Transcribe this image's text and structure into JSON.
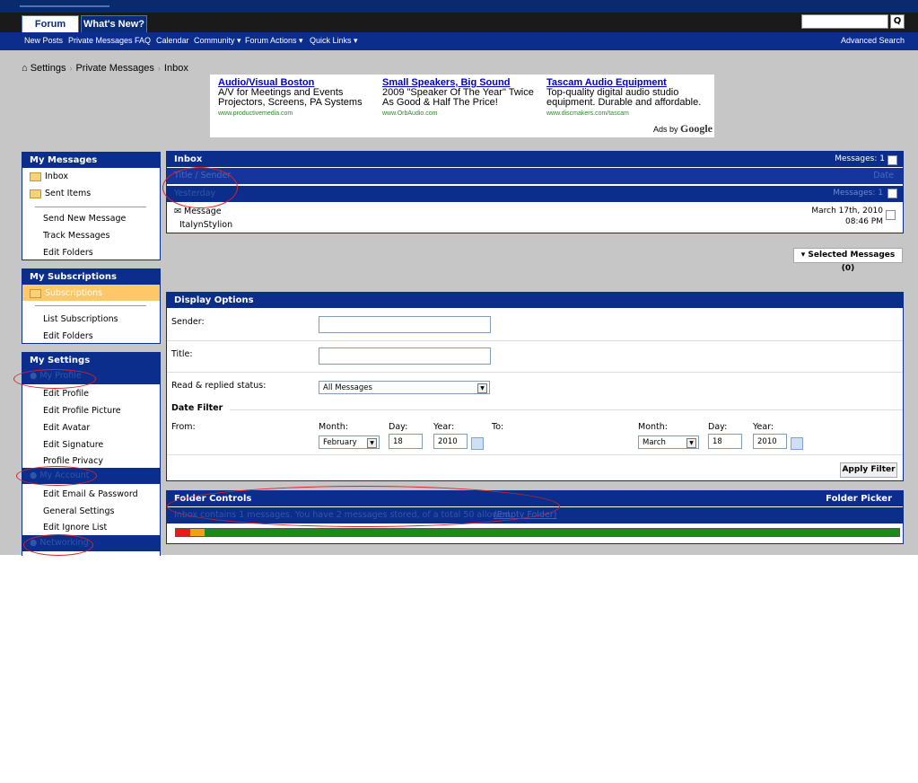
{
  "header": {
    "tabs": [
      {
        "label": "Forum"
      },
      {
        "label": "What's New?"
      }
    ],
    "search_button": "Q"
  },
  "subnav": {
    "items": [
      "New Posts",
      "Private Messages",
      "FAQ",
      "Calendar",
      "Community ▾",
      "Forum Actions ▾",
      "Quick Links ▾"
    ],
    "advanced_search": "Advanced Search"
  },
  "breadcrumb": {
    "items": [
      "Settings",
      "Private Messages",
      "Inbox"
    ]
  },
  "ads": {
    "items": [
      {
        "title": "Audio/Visual Boston",
        "line1": "A/V for Meetings and Events",
        "line2": "Projectors, Screens, PA Systems",
        "url": "www.productivemedia.com"
      },
      {
        "title": "Small Speakers, Big Sound",
        "line1": "2009 \"Speaker Of The Year\" Twice",
        "line2": "As Good & Half The Price!",
        "url": "www.OrbAudio.com"
      },
      {
        "title": "Tascam Audio Equipment",
        "line1": "Top-quality digital audio studio",
        "line2": "equipment. Durable and affordable.",
        "url": "www.discmakers.com/tascam"
      }
    ],
    "ads_by": "Ads by",
    "google": "Google"
  },
  "sidebar": {
    "my_messages": {
      "title": "My Messages",
      "inbox": "Inbox",
      "sent": "Sent Items",
      "send_new": "Send New Message",
      "track": "Track Messages",
      "edit_folders": "Edit Folders"
    },
    "my_subscriptions": {
      "title": "My Subscriptions",
      "subscriptions": "Subscriptions",
      "list": "List Subscriptions",
      "edit_folders": "Edit Folders"
    },
    "my_settings": {
      "title": "My Settings",
      "my_profile": "My Profile",
      "edit_profile": "Edit Profile",
      "edit_picture": "Edit Profile Picture",
      "edit_avatar": "Edit Avatar",
      "edit_signature": "Edit Signature",
      "privacy": "Profile Privacy",
      "my_account": "My Account",
      "edit_email": "Edit Email & Password",
      "general": "General Settings",
      "ignore": "Edit Ignore List",
      "networking": "Networking"
    }
  },
  "inbox": {
    "title": "Inbox",
    "messages_count": "Messages: 1",
    "col_title": "Title / Sender",
    "col_date": "Date",
    "group": "Yesterday",
    "group_count": "Messages: 1",
    "message": {
      "title": "Message",
      "sender": "ItalynStylion",
      "date": "March 17th, 2010",
      "time": "08:46 PM"
    }
  },
  "selected_messages": "▾ Selected Messages (0)",
  "display_options": {
    "title": "Display Options",
    "sender_label": "Sender:",
    "title_label": "Title:",
    "status_label": "Read & replied status:",
    "status_value": "All Messages",
    "date_filter": "Date Filter",
    "from": "From:",
    "to": "To:",
    "month": "Month:",
    "day": "Day:",
    "year": "Year:",
    "from_month": "February",
    "from_day": "18",
    "from_year": "2010",
    "to_month": "March",
    "to_day": "18",
    "to_year": "2010",
    "apply": "Apply Filter"
  },
  "folder_controls": {
    "title": "Folder Controls",
    "picker": "Folder Picker",
    "quota_text": "Inbox contains 1 messages. You have 2 messages stored, of a total 50 allowed.",
    "empty_folder": "(Empty Folder)",
    "usage_fraction": 0.04
  }
}
